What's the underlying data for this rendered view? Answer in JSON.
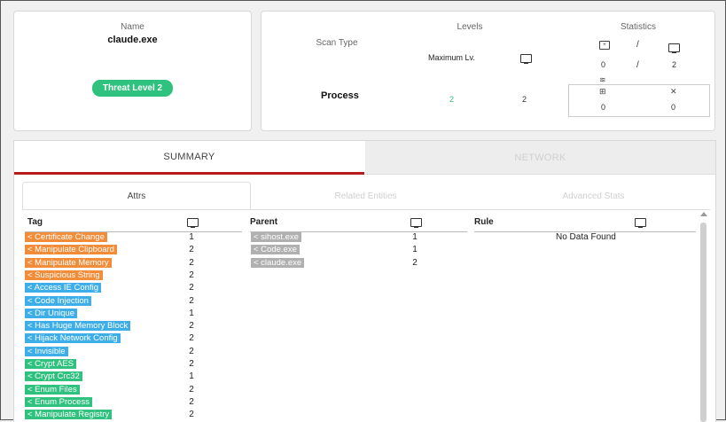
{
  "name_card": {
    "label": "Name",
    "value": "claude.exe",
    "threat_badge": "Threat Level 2"
  },
  "levels_card": {
    "levels_label": "Levels",
    "statistics_label": "Statistics",
    "scan_type_label": "Scan Type",
    "max_level_label": "Maximum Lv.",
    "process_label": "Process",
    "process_level": "2",
    "process_hosts": "2",
    "stats_slash": "/",
    "stat_top_left": "0",
    "stat_top_right": "2",
    "stat_bottom_left": "0",
    "stat_bottom_right": "0"
  },
  "tabs": {
    "summary": "SUMMARY",
    "network": "NETWORK"
  },
  "subtabs": {
    "attrs": "Attrs",
    "related": "Related Entities",
    "advanced": "Advanced Stats"
  },
  "columns": {
    "tag": "Tag",
    "parent": "Parent",
    "rule": "Rule"
  },
  "tags": [
    {
      "label": "< Certificate Change",
      "count": "1",
      "color": "orange"
    },
    {
      "label": "< Manipulate Clipboard",
      "count": "2",
      "color": "orange"
    },
    {
      "label": "< Manipulate Memory",
      "count": "2",
      "color": "orange"
    },
    {
      "label": "< Suspicious String",
      "count": "2",
      "color": "orange"
    },
    {
      "label": "< Access IE Config",
      "count": "2",
      "color": "blue"
    },
    {
      "label": "< Code Injection",
      "count": "2",
      "color": "blue"
    },
    {
      "label": "< Dir Unique",
      "count": "1",
      "color": "blue"
    },
    {
      "label": "< Has Huge Memory Block",
      "count": "2",
      "color": "blue"
    },
    {
      "label": "< Hijack Network Config",
      "count": "2",
      "color": "blue"
    },
    {
      "label": "< Invisible",
      "count": "2",
      "color": "blue"
    },
    {
      "label": "< Crypt AES",
      "count": "2",
      "color": "green"
    },
    {
      "label": "< Crypt Crc32",
      "count": "1",
      "color": "green"
    },
    {
      "label": "< Enum Files",
      "count": "2",
      "color": "green"
    },
    {
      "label": "< Enum Process",
      "count": "2",
      "color": "green"
    },
    {
      "label": "< Manipulate Registry",
      "count": "2",
      "color": "green"
    }
  ],
  "parents": [
    {
      "label": "< sihost.exe",
      "count": "1"
    },
    {
      "label": "< Code.exe",
      "count": "1"
    },
    {
      "label": "< claude.exe",
      "count": "2"
    }
  ],
  "rules": {
    "empty_text": "No Data Found"
  },
  "colors": {
    "orange": "#f28c38",
    "blue": "#3daee9",
    "green": "#2ec27e",
    "gray": "#b0b0b0",
    "accent_red": "#b71c1c"
  }
}
